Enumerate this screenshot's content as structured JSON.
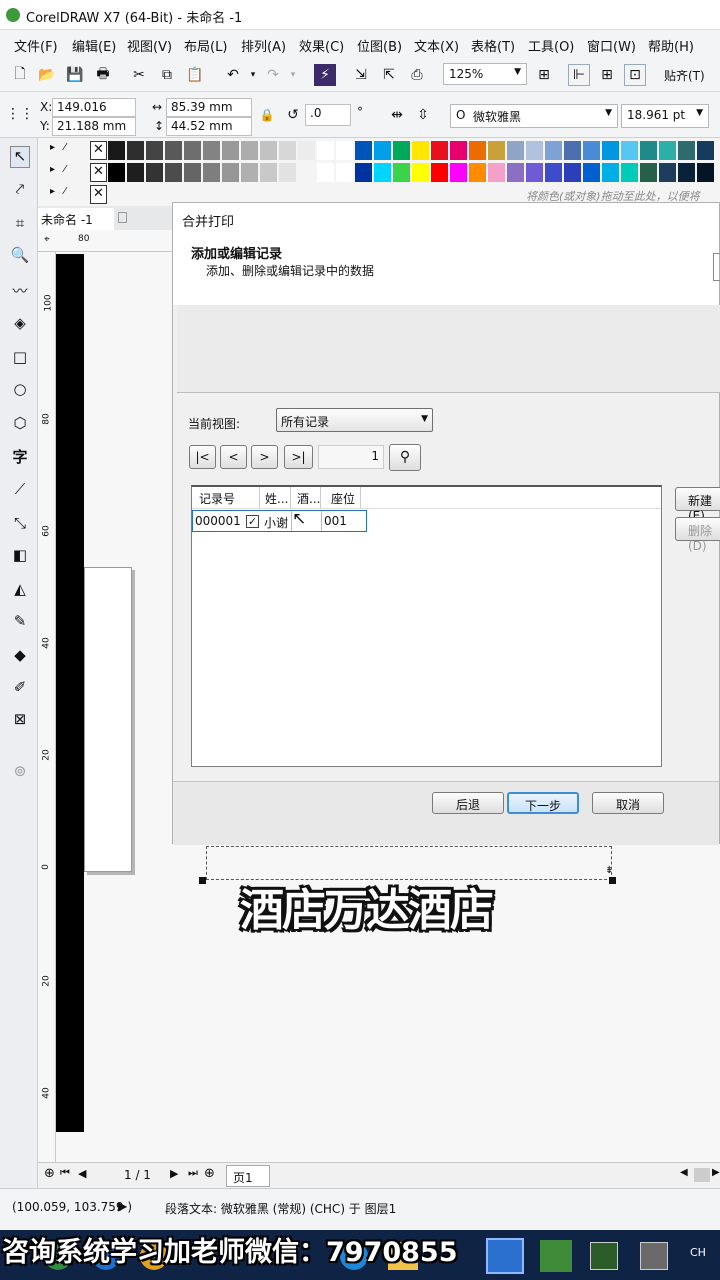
{
  "window": {
    "title": "CorelDRAW X7 (64-Bit) - 未命名 -1"
  },
  "menu": [
    "文件(F)",
    "编辑(E)",
    "视图(V)",
    "布局(L)",
    "排列(A)",
    "效果(C)",
    "位图(B)",
    "文本(X)",
    "表格(T)",
    "工具(O)",
    "窗口(W)",
    "帮助(H)"
  ],
  "toolbar": {
    "zoom": "125%",
    "snap_label": "贴齐(T)"
  },
  "props": {
    "x": "149.016 mm",
    "y": "21.188 mm",
    "w": "85.39 mm",
    "h": "44.52 mm",
    "x_label": "X:",
    "y_label": "Y:",
    "angle": ".0",
    "angle_unit": "°",
    "font": "微软雅黑",
    "font_size": "18.961 pt"
  },
  "palette": {
    "hint": "将颜色(或对象)拖动至此处，以便将",
    "row1": [
      "#191919",
      "#2e2e2e",
      "#444",
      "#595959",
      "#6e6e6e",
      "#838383",
      "#999",
      "#adadad",
      "#c2c2c2",
      "#d7d7d7",
      "#ececec",
      "#fff",
      "#fff",
      "#0055b8",
      "#00a0e8",
      "#00a85a",
      "#ffe600",
      "#e8101d",
      "#e8006f",
      "#ed6c00",
      "#c9a13a",
      "#8fa4c7",
      "#b2c1dd",
      "#7da2d5",
      "#4d6fb0",
      "#4a8bd5",
      "#0097e0",
      "#56c7f0",
      "#1f8a8a",
      "#2ab0a8",
      "#2f6a70",
      "#153c5e"
    ],
    "row2": [
      "#000",
      "#1e1e1e",
      "#333",
      "#4c4c4c",
      "#656565",
      "#7e7e7e",
      "#979797",
      "#b0b0b0",
      "#c9c9c9",
      "#e2e2e2",
      "#f4f4f4",
      "#fff",
      "#fff",
      "#0033a0",
      "#00d4ff",
      "#3ad34a",
      "#ffff00",
      "#ff0000",
      "#ff00ff",
      "#ff8c00",
      "#f3a1c8",
      "#8a6fc2",
      "#6f5bd6",
      "#3d4cc8",
      "#2c3fb8",
      "#0060d0",
      "#00aee6",
      "#00cbb9",
      "#27604a",
      "#1d3d5c",
      "#0a2238",
      "#061526"
    ]
  },
  "doc": {
    "tab": "未命名 -1",
    "ruler_h": "80",
    "ruler_v": [
      "100",
      "80",
      "60",
      "40",
      "20",
      "0",
      "20",
      "40"
    ]
  },
  "dialog": {
    "title": "合并打印",
    "header_title": "添加或编辑记录",
    "header_sub": "添加、删除或编辑记录中的数据",
    "view_label": "当前视图:",
    "view_value": "所有记录",
    "nav": [
      "|<",
      "<",
      ">",
      ">|"
    ],
    "record_no": "1",
    "columns": [
      "记录号",
      "姓...",
      "酒...",
      "座位"
    ],
    "rows": [
      {
        "id": "000001",
        "name": "小谢",
        "seat": "001"
      }
    ],
    "new_btn": "新建(E)",
    "delete_btn": "删除(D)",
    "back_btn": "后退",
    "next_btn": "下一步",
    "cancel_btn": "取消"
  },
  "canvas_text": "酒店万达酒店",
  "pagenav": {
    "count": "1 / 1",
    "tab": "页1"
  },
  "status": {
    "coords": "(100.059, 103.759 )",
    "info": "段落文本: 微软雅黑 (常规) (CHC) 于 图层1"
  },
  "overlay_text": "咨询系统学习加老师微信：7970855",
  "taskbar": {
    "lang": "CH"
  }
}
